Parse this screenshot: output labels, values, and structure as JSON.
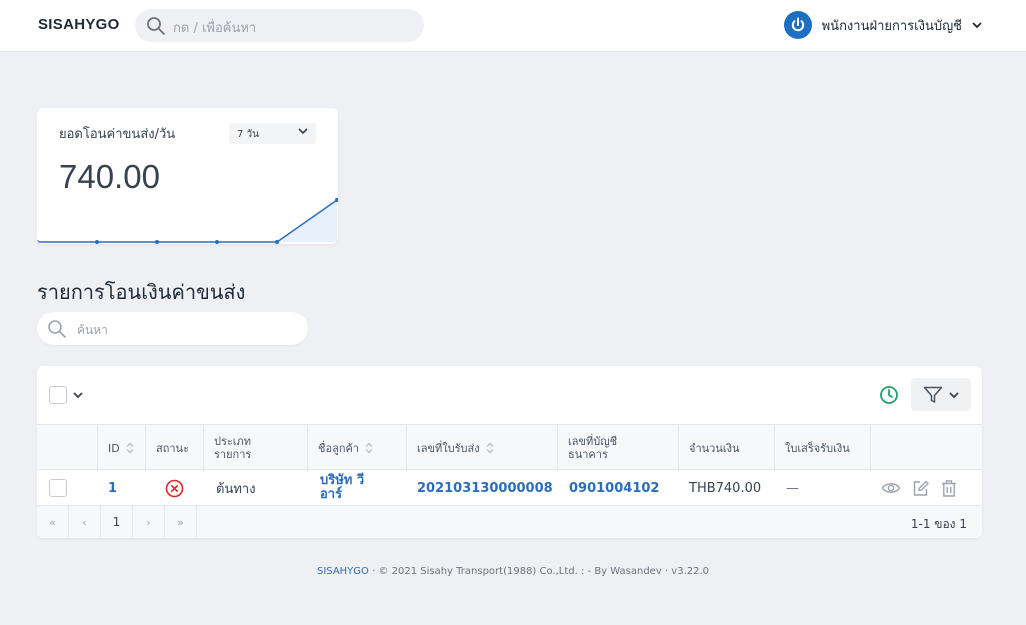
{
  "header": {
    "brand": "SISAHYGO",
    "search_placeholder": "กด / เพื่อค้นหา",
    "user_name": "พนักงานฝ่ายการเงินบัญชี"
  },
  "stat_card": {
    "title": "ยอดโอนค่าขนส่ง/วัน",
    "range": "7 วัน",
    "value": "740.00",
    "trend": [
      0,
      0,
      0,
      0,
      0,
      740
    ]
  },
  "section": {
    "title": "รายการโอนเงินค่าขนส่ง",
    "search_placeholder": "ค้นหา"
  },
  "table": {
    "columns": [
      "ID",
      "สถานะ",
      "ประเภท\nรายการ",
      "ชื่อลูกค้า",
      "เลขที่ใบรับส่ง",
      "เลขที่บัญชี\nธนาคาร",
      "จำนวนเงิน",
      "ใบเสร็จรับเงิน"
    ],
    "rows": [
      {
        "id": "1",
        "status": "cancelled",
        "type": "ต้นทาง",
        "customer": "บริษัท วี อาร์",
        "waybill": "202103130000008",
        "bank_account": "0901004102",
        "amount": "THB740.00",
        "receipt": "—"
      }
    ],
    "pagination": {
      "first": "«",
      "prev": "‹",
      "page": "1",
      "next": "›",
      "last": "»",
      "range_text": "1-1 ของ 1"
    }
  },
  "footer": {
    "brand": "SISAHYGO",
    "text": "· © 2021 Sisahy Transport(1988) Co.,Ltd. : - By Wasandev · v3.22.0"
  },
  "colors": {
    "accent": "#2a6ebb",
    "success": "#22a06b",
    "danger": "#dc2626"
  }
}
